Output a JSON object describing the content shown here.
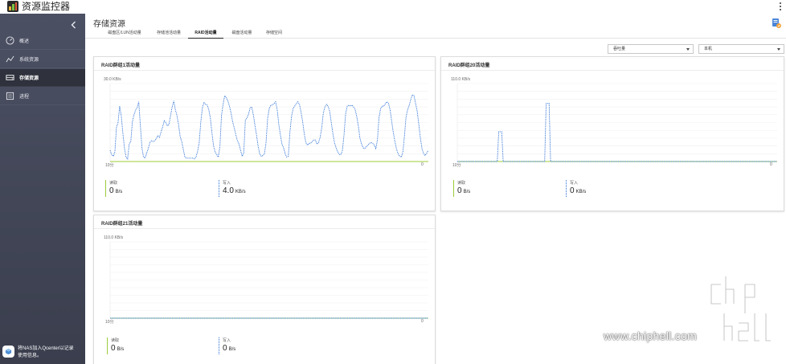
{
  "app": {
    "title": "资源监控器"
  },
  "sidebar": {
    "items": [
      {
        "label": "概述",
        "icon": "gauge-icon",
        "active": false
      },
      {
        "label": "系统资源",
        "icon": "line-chart-icon",
        "active": false
      },
      {
        "label": "存储资源",
        "icon": "storage-icon",
        "active": true
      },
      {
        "label": "进程",
        "icon": "list-icon",
        "active": false
      }
    ],
    "promo_line1": "将NAS加入Qcenter以记录",
    "promo_line2": "使用信息。"
  },
  "main": {
    "page_title": "存储资源",
    "tabs": [
      {
        "label": "磁盘区/LUN活动量",
        "active": false
      },
      {
        "label": "存储池活动量",
        "active": false
      },
      {
        "label": "RAID活动量",
        "active": true
      },
      {
        "label": "磁盘活动量",
        "active": false
      },
      {
        "label": "存储空间",
        "active": false
      }
    ],
    "filter_metric": "吞吐量",
    "filter_scope": "本机"
  },
  "chart_data": [
    {
      "type": "line",
      "title": "RAID群组1活动量",
      "y_max_label": "30.0 KB/s",
      "ylim": [
        0,
        30
      ],
      "x_start_label": "10分",
      "x_end_label": "0",
      "series": [
        {
          "name": "读取",
          "color": "#9ccc3a",
          "values": [
            0,
            0,
            0,
            0,
            0,
            0,
            0,
            0,
            0,
            0,
            0,
            0,
            0,
            0,
            0,
            0,
            0,
            0,
            0,
            0,
            0,
            0,
            0,
            0,
            0,
            0,
            0,
            0,
            0,
            0,
            0,
            0,
            0,
            0,
            0,
            0,
            0,
            0,
            0,
            0,
            0,
            0,
            0,
            0,
            0,
            0,
            0,
            0,
            0,
            0,
            0,
            0,
            0,
            0,
            0,
            0,
            0,
            0,
            0,
            0,
            0,
            0,
            0,
            0,
            0,
            0,
            0,
            0,
            0,
            0,
            0,
            0,
            0,
            0,
            0,
            0,
            0,
            0,
            0,
            0,
            0,
            0,
            0,
            0,
            0,
            0,
            0,
            0,
            0,
            0,
            0,
            0,
            0,
            0,
            0,
            0,
            0,
            0,
            0,
            0,
            0,
            0,
            0,
            0,
            0,
            0,
            0,
            0,
            0,
            0,
            0,
            0,
            0,
            0,
            0,
            0,
            0,
            0,
            0,
            0,
            0,
            0,
            0,
            0,
            0,
            0,
            0,
            0,
            0,
            0,
            0,
            0,
            0,
            0,
            0,
            0,
            0,
            0,
            0,
            0,
            0,
            0,
            0,
            0,
            0,
            0,
            0,
            0,
            0,
            0,
            0,
            0,
            0,
            0,
            0,
            0,
            0,
            0,
            0,
            0,
            0,
            0,
            0,
            0,
            0,
            0,
            0,
            0,
            0,
            0,
            0,
            0,
            0,
            0,
            0,
            0,
            0,
            0,
            0,
            0,
            0,
            0,
            0,
            0,
            0,
            0,
            0,
            0,
            0,
            0,
            0,
            0,
            0,
            0,
            0,
            0,
            0,
            0,
            0,
            0
          ]
        },
        {
          "name": "写入",
          "color": "#2a6fd6",
          "values": [
            4.3,
            2.7,
            2.0,
            3.7,
            13.3,
            15.0,
            21.3,
            17.7,
            11.0,
            5.3,
            1.7,
            1.0,
            6.7,
            7.7,
            15.3,
            18.0,
            19.7,
            20.7,
            23.0,
            14.0,
            5.3,
            1.7,
            1.3,
            3.3,
            5.0,
            7.3,
            8.0,
            7.7,
            8.0,
            8.7,
            10.0,
            9.3,
            11.3,
            13.3,
            15.7,
            15.0,
            13.7,
            14.3,
            17.7,
            21.0,
            23.3,
            20.0,
            17.7,
            14.3,
            9.7,
            7.7,
            4.7,
            1.7,
            1.3,
            1.3,
            1.3,
            1.3,
            1.3,
            1.0,
            1.7,
            4.0,
            7.3,
            15.3,
            20.7,
            22.7,
            22.0,
            21.7,
            20.0,
            16.7,
            11.0,
            6.0,
            3.7,
            2.7,
            1.7,
            5.7,
            17.7,
            22.0,
            25.3,
            24.7,
            23.3,
            21.3,
            18.7,
            15.3,
            13.0,
            10.3,
            8.0,
            6.7,
            4.3,
            2.0,
            3.3,
            16.0,
            16.7,
            18.3,
            20.7,
            21.0,
            18.0,
            14.0,
            10.3,
            6.0,
            3.0,
            2.0,
            2.3,
            3.0,
            7.3,
            16.7,
            20.3,
            21.7,
            21.7,
            22.3,
            23.0,
            20.0,
            14.3,
            10.3,
            6.7,
            5.3,
            3.0,
            1.7,
            2.0,
            11.3,
            17.3,
            20.3,
            21.3,
            22.3,
            23.0,
            22.0,
            19.0,
            15.3,
            10.7,
            7.3,
            6.3,
            7.0,
            7.0,
            7.7,
            8.3,
            8.3,
            6.7,
            7.3,
            9.3,
            13.0,
            18.7,
            21.0,
            22.0,
            21.3,
            19.3,
            15.0,
            10.7,
            7.3,
            5.3,
            3.7,
            2.7,
            2.7,
            4.3,
            10.3,
            18.3,
            21.3,
            21.7,
            21.3,
            21.7,
            21.0,
            20.0,
            17.3,
            13.7,
            9.0,
            6.7,
            5.3,
            5.0,
            5.7,
            6.3,
            7.0,
            7.3,
            7.0,
            6.3,
            5.0,
            8.3,
            17.0,
            20.3,
            21.3,
            21.3,
            22.3,
            23.0,
            22.3,
            19.7,
            15.3,
            11.0,
            7.7,
            4.7,
            3.0,
            2.0,
            1.7,
            3.7,
            10.0,
            17.3,
            20.0,
            21.7,
            24.0,
            25.7,
            25.3,
            22.3,
            19.3,
            14.3,
            9.0,
            5.0,
            3.0,
            2.3,
            3.3,
            4.3
          ]
        }
      ],
      "stats": [
        {
          "label": "读取",
          "value": "0",
          "unit": "B/s"
        },
        {
          "label": "写入",
          "value": "4.0",
          "unit": "KB/s"
        }
      ]
    },
    {
      "type": "line",
      "title": "RAID群组20活动量",
      "y_max_label": "110.0 KB/s",
      "ylim": [
        0,
        110
      ],
      "x_start_label": "10分",
      "x_end_label": "0",
      "series": [
        {
          "name": "读取",
          "color": "#9ccc3a",
          "values": [
            0,
            0,
            0,
            0,
            0,
            0,
            0,
            0,
            0,
            0,
            0,
            0,
            0,
            0,
            0,
            0,
            0,
            0,
            0,
            0,
            0,
            0,
            0,
            0,
            0,
            0,
            0,
            0,
            0,
            0,
            0,
            0,
            0,
            0,
            0,
            0,
            0,
            0,
            0,
            0,
            0,
            0,
            0,
            0,
            0,
            0,
            0,
            0,
            0,
            0
          ]
        },
        {
          "name": "写入",
          "color": "#2a6fd6",
          "values": [
            0,
            0,
            0,
            0,
            0,
            0,
            0,
            0,
            0,
            0,
            0,
            0,
            0,
            0,
            0,
            0,
            0,
            0,
            0,
            0,
            0,
            0,
            0,
            0,
            0,
            0,
            0,
            0,
            42,
            42,
            42,
            0,
            0,
            0,
            0,
            0,
            0,
            0,
            0,
            0,
            0,
            0,
            0,
            0,
            0,
            0,
            0,
            0,
            0,
            0,
            0,
            0,
            0,
            0,
            0,
            0,
            0,
            0,
            0,
            0,
            82,
            82,
            82,
            0,
            0,
            0,
            0,
            0,
            0,
            0,
            0,
            0,
            0,
            0,
            0,
            0,
            0,
            0,
            0,
            0,
            0,
            0,
            0,
            0,
            0,
            0,
            0,
            0,
            0,
            0,
            0,
            0,
            0,
            0,
            0,
            0,
            0,
            0,
            0,
            0,
            0,
            0,
            0,
            0,
            0,
            0,
            0,
            0,
            0,
            0,
            0,
            0,
            0,
            0,
            0,
            0,
            0,
            0,
            0,
            0,
            0,
            0,
            0,
            0,
            0,
            0,
            0,
            0,
            0,
            0,
            0,
            0,
            0,
            0,
            0,
            0,
            0,
            0,
            0,
            0,
            0,
            0,
            0,
            0,
            0,
            0,
            0,
            0,
            0,
            0,
            0,
            0,
            0,
            0,
            0,
            0,
            0,
            0,
            0,
            0,
            0,
            0,
            0,
            0,
            0,
            0,
            0,
            0,
            0,
            0,
            0,
            0,
            0,
            0,
            0,
            0,
            0,
            0,
            0,
            0,
            0,
            0,
            0,
            0,
            0,
            0,
            0,
            0,
            0,
            0,
            0,
            0,
            0,
            0,
            0,
            0,
            0,
            0,
            0,
            0,
            0,
            0,
            0,
            0,
            0,
            0,
            0,
            0,
            0,
            0,
            0,
            0,
            0,
            0,
            0,
            0,
            0
          ]
        }
      ],
      "stats": [
        {
          "label": "读取",
          "value": "0",
          "unit": "B/s"
        },
        {
          "label": "写入",
          "value": "0",
          "unit": "KB/s"
        }
      ]
    },
    {
      "type": "area",
      "title": "RAID群组21活动量",
      "y_max_label": "110.0 KB/s",
      "ylim": [
        0,
        110
      ],
      "x_start_label": "10分",
      "x_end_label": "0",
      "series": [
        {
          "name": "读取",
          "color": "#7cc243",
          "values": [
            0,
            0,
            0,
            0,
            0,
            0,
            0,
            0,
            0,
            0,
            0,
            0,
            0,
            0,
            0,
            0,
            0,
            0,
            0,
            0,
            0,
            0,
            0,
            0,
            0,
            0,
            0,
            0,
            0,
            0,
            0,
            0,
            0,
            0,
            0,
            0,
            0,
            0,
            0,
            0,
            0,
            0,
            0,
            0,
            0,
            0,
            0,
            0,
            0,
            0,
            0,
            0,
            0,
            0,
            0,
            0,
            0,
            0,
            0,
            0,
            0,
            0,
            0,
            0,
            0,
            0,
            0,
            0,
            0,
            0,
            0,
            0,
            0,
            0,
            0,
            0,
            0,
            0,
            0,
            0,
            0,
            0,
            0,
            0,
            0,
            0,
            0,
            0,
            0,
            0,
            0,
            0,
            0,
            0,
            0,
            0,
            0,
            0,
            0,
            0,
            0,
            0,
            0,
            0,
            0,
            0,
            0,
            0,
            0,
            0,
            0,
            0,
            0,
            0,
            0,
            0,
            0,
            0,
            0,
            0,
            0,
            0,
            0,
            0,
            0,
            0,
            0,
            0,
            0,
            0,
            0,
            0,
            0,
            0,
            0,
            0,
            0,
            0,
            0,
            0,
            0,
            0,
            0,
            0,
            0,
            0,
            0,
            0,
            0,
            0,
            0,
            0,
            0,
            0,
            0,
            0,
            0,
            0,
            0,
            0,
            0,
            0,
            0,
            0,
            0,
            0,
            0,
            0,
            0,
            0,
            0,
            0,
            0,
            0,
            0,
            0,
            0,
            0,
            0,
            0,
            0,
            0,
            0,
            0,
            0,
            0,
            0,
            0,
            0,
            0,
            0,
            0,
            0,
            0,
            0,
            0,
            0,
            0,
            0,
            0,
            0
          ]
        },
        {
          "name": "写入",
          "color": "#2a6fd6",
          "values": [
            0,
            0,
            0,
            0,
            0,
            0,
            0,
            0,
            0,
            0,
            0,
            0,
            0,
            0,
            0,
            0,
            0,
            0,
            0,
            0,
            0,
            0,
            0,
            0,
            0,
            0,
            0,
            0,
            0,
            0,
            0,
            0,
            0,
            0,
            0,
            0,
            0,
            0,
            0,
            0,
            0,
            0,
            0,
            0,
            0,
            0,
            0,
            0,
            0,
            0,
            0,
            0,
            0,
            0,
            0,
            0,
            0,
            0,
            0,
            0,
            0,
            0,
            0,
            0,
            0,
            0,
            0,
            0,
            0,
            0,
            0,
            0,
            0,
            0,
            0,
            0,
            0,
            0,
            0,
            0,
            0,
            0,
            0,
            0,
            0,
            0,
            0,
            0,
            0,
            0,
            0,
            0,
            0,
            0,
            0,
            0,
            0,
            0,
            0,
            0,
            0,
            0,
            0,
            0,
            0,
            0,
            0,
            0,
            0,
            0,
            0,
            0,
            0,
            0,
            0,
            0,
            0,
            0,
            0,
            0,
            0,
            0,
            0,
            0,
            0,
            0,
            0,
            0,
            0,
            0,
            0,
            0,
            0,
            0,
            0,
            0,
            0,
            0,
            0,
            0,
            0,
            0,
            0,
            0,
            0,
            0,
            0,
            0,
            0,
            0,
            0,
            0,
            0,
            0,
            0,
            0,
            0,
            0,
            0,
            0,
            0,
            0,
            0,
            0,
            0,
            0,
            0,
            0,
            0,
            0,
            0,
            0,
            0,
            0,
            0,
            0,
            0,
            0,
            0,
            0,
            0,
            0,
            0,
            0,
            0,
            0,
            0,
            0,
            0,
            0,
            0,
            0,
            0,
            0,
            0,
            0,
            0,
            0,
            0,
            0,
            0
          ]
        }
      ],
      "stats": [
        {
          "label": "读取",
          "value": "0",
          "unit": "B/s"
        },
        {
          "label": "写入",
          "value": "0",
          "unit": "B/s"
        }
      ]
    }
  ],
  "watermark": {
    "text": "www.chiphell.com",
    "logo_text": "chiphell"
  }
}
